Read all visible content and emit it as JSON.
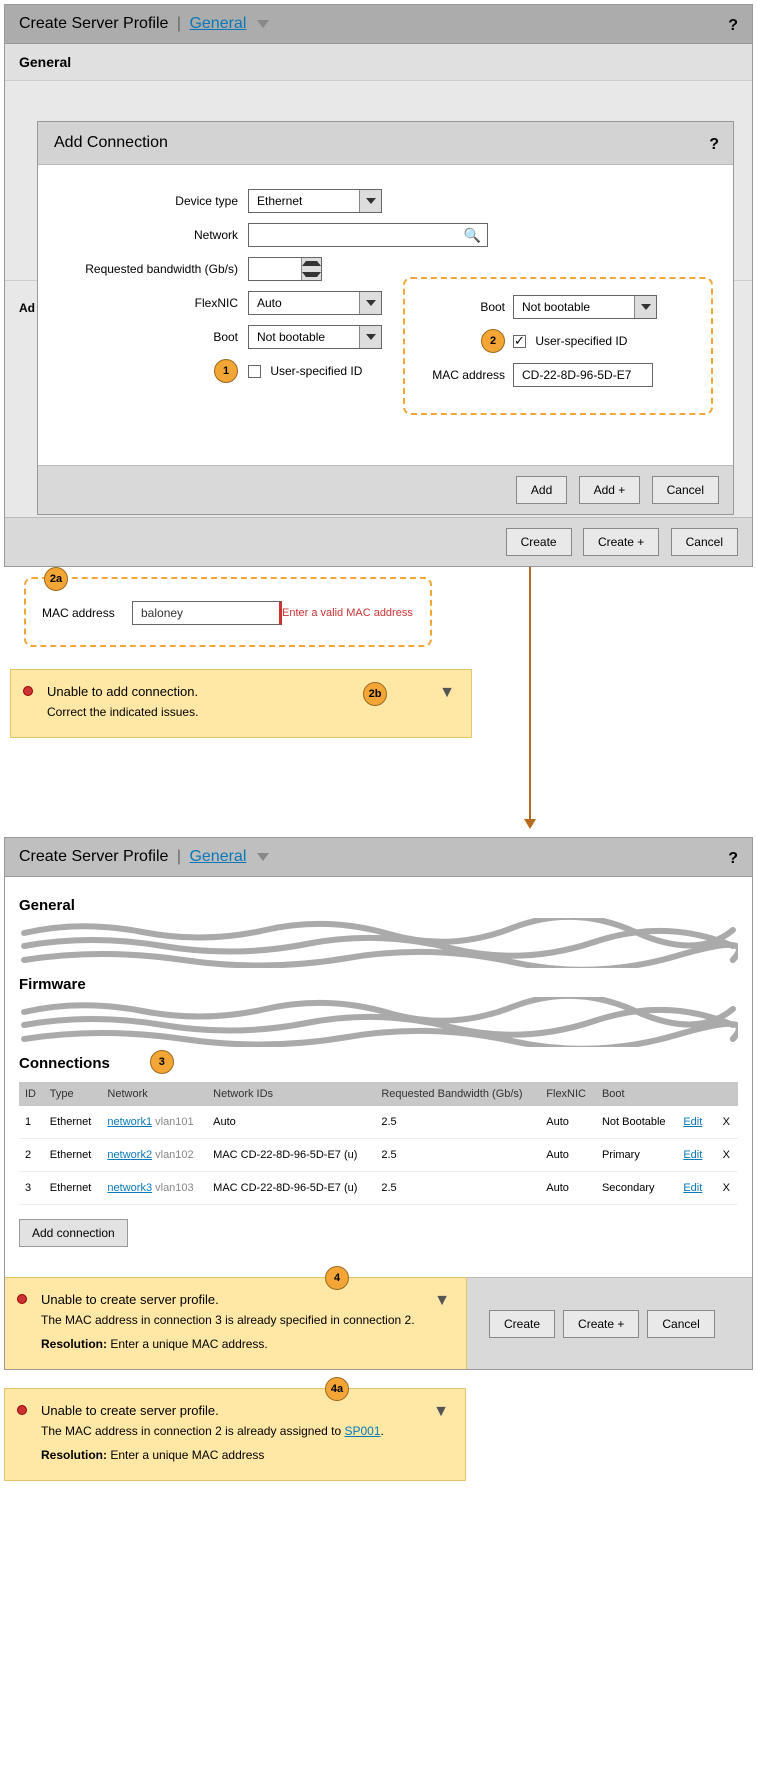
{
  "panel1": {
    "title_prefix": "Create Server Profile",
    "title_link": "General",
    "help": "?",
    "sub_general": "General",
    "clipped_label": "Ad"
  },
  "modal": {
    "title": "Add Connection",
    "help": "?",
    "fields": {
      "device_type_label": "Device type",
      "device_type_value": "Ethernet",
      "network_label": "Network",
      "bandwidth_label": "Requested bandwidth (Gb/s)",
      "flexnic_label": "FlexNIC",
      "flexnic_value": "Auto",
      "boot_label": "Boot",
      "boot_value": "Not bootable",
      "user_id_label": "User-specified ID"
    },
    "callout2": {
      "boot_label": "Boot",
      "boot_value": "Not bootable",
      "user_id_label": "User-specified ID",
      "mac_label": "MAC address",
      "mac_value": "CD-22-8D-96-5D-E7"
    },
    "buttons": {
      "add": "Add",
      "add_plus": "Add +",
      "cancel": "Cancel"
    }
  },
  "panel1_footer": {
    "create": "Create",
    "create_plus": "Create +",
    "cancel": "Cancel"
  },
  "markers": {
    "m1": "1",
    "m2": "2",
    "m2a": "2a",
    "m2b": "2b",
    "m3": "3",
    "m4": "4",
    "m4a": "4a"
  },
  "callout2a": {
    "mac_label": "MAC address",
    "mac_value": "baloney",
    "error_msg": "Enter a valid MAC address"
  },
  "notif2b": {
    "title": "Unable to add connection.",
    "body": "Correct the indicated issues."
  },
  "panel2": {
    "title_prefix": "Create Server Profile",
    "title_link": "General",
    "help": "?",
    "sec_general": "General",
    "sec_firmware": "Firmware",
    "sec_connections": "Connections",
    "table": {
      "headers": {
        "id": "ID",
        "type": "Type",
        "network": "Network",
        "netids": "Network IDs",
        "bw": "Requested Bandwidth (Gb/s)",
        "flex": "FlexNIC",
        "boot": "Boot"
      },
      "rows": [
        {
          "id": "1",
          "type": "Ethernet",
          "net": "network1",
          "vlan": "vlan101",
          "netids": "Auto",
          "bw": "2.5",
          "flex": "Auto",
          "boot": "Not Bootable",
          "edit": "Edit",
          "x": "X"
        },
        {
          "id": "2",
          "type": "Ethernet",
          "net": "network2",
          "vlan": "vlan102",
          "netids": "MAC CD-22-8D-96-5D-E7 (u)",
          "bw": "2.5",
          "flex": "Auto",
          "boot": "Primary",
          "edit": "Edit",
          "x": "X"
        },
        {
          "id": "3",
          "type": "Ethernet",
          "net": "network3",
          "vlan": "vlan103",
          "netids": "MAC CD-22-8D-96-5D-E7 (u)",
          "bw": "2.5",
          "flex": "Auto",
          "boot": "Secondary",
          "edit": "Edit",
          "x": "X"
        }
      ]
    },
    "add_connection": "Add connection",
    "footer": {
      "create": "Create",
      "create_plus": "Create +",
      "cancel": "Cancel"
    }
  },
  "notif4": {
    "title": "Unable to create server profile.",
    "line1": "The MAC address in connection 3 is already specified in connection 2.",
    "res_label": "Resolution:",
    "res_text": " Enter a unique MAC address."
  },
  "notif4a": {
    "title": "Unable to create server profile.",
    "line1a": "The MAC address in connection 2 is already assigned to ",
    "line1_link": "SP001",
    "line1b": ".",
    "res_label": "Resolution:",
    "res_text": " Enter a unique MAC address"
  }
}
